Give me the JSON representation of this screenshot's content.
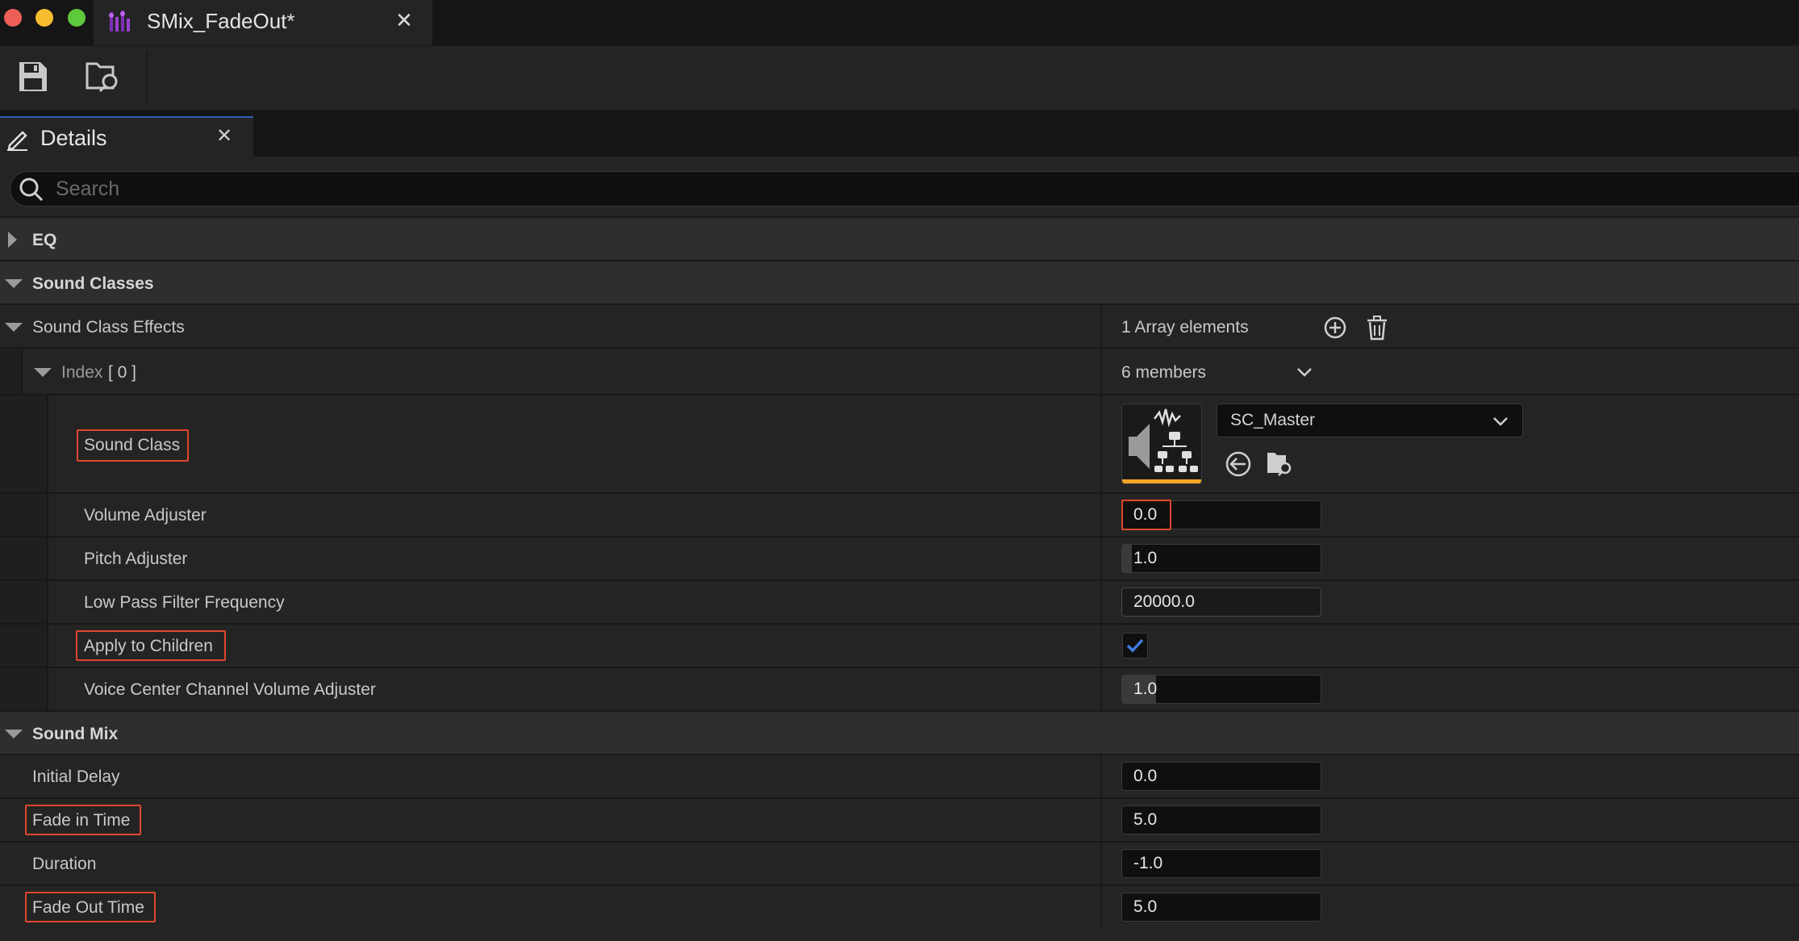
{
  "window": {
    "title": "SMix_FadeOut*"
  },
  "toolbar": {
    "save_icon": "save-icon",
    "browse_icon": "browse-asset-icon"
  },
  "panel": {
    "tab_label": "Details"
  },
  "search": {
    "placeholder": "Search",
    "value": ""
  },
  "categories": {
    "eq": "EQ",
    "sound_classes": "Sound Classes",
    "sound_mix": "Sound Mix"
  },
  "sound_class_effects": {
    "label": "Sound Class Effects",
    "array_count": "1 Array elements",
    "index_label": "Index",
    "index_value": "[ 0 ]",
    "members": "6 members"
  },
  "element": {
    "sound_class": {
      "label": "Sound Class",
      "value": "SC_Master"
    },
    "volume_adjuster": {
      "label": "Volume Adjuster",
      "value": "0.0",
      "fill": 0.0
    },
    "pitch_adjuster": {
      "label": "Pitch Adjuster",
      "value": "1.0",
      "fill": 0.05
    },
    "low_pass": {
      "label": "Low Pass Filter Frequency",
      "value": "20000.0"
    },
    "apply_to_children": {
      "label": "Apply to Children",
      "checked": true
    },
    "voice_center": {
      "label": "Voice Center Channel Volume Adjuster",
      "value": "1.0",
      "fill": 0.17
    }
  },
  "sound_mix": {
    "initial_delay": {
      "label": "Initial Delay",
      "value": "0.0"
    },
    "fade_in_time": {
      "label": "Fade in Time",
      "value": "5.0"
    },
    "duration": {
      "label": "Duration",
      "value": "-1.0"
    },
    "fade_out_time": {
      "label": "Fade Out Time",
      "value": "5.0"
    }
  },
  "colors": {
    "highlight": "#e0472d",
    "accent": "#2f5fb5",
    "thumb_bar": "#f5a623",
    "check": "#3d7be0"
  }
}
